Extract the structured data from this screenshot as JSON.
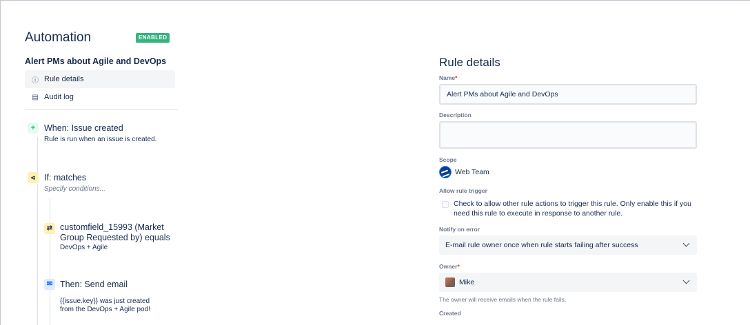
{
  "header": {
    "title": "Automation",
    "status_badge": "ENABLED",
    "rule_name": "Alert PMs about Agile and DevOps"
  },
  "nav": {
    "items": [
      {
        "label": "Rule details",
        "icon": "info-icon",
        "active": true
      },
      {
        "label": "Audit log",
        "icon": "document-icon",
        "active": false
      }
    ]
  },
  "steps": {
    "trigger": {
      "title": "When: Issue created",
      "description": "Rule is run when an issue is created.",
      "icon": "plus-icon",
      "color": "#36b37e"
    },
    "condition": {
      "title": "If: matches",
      "description": "Specify conditions...",
      "icon": "branch-icon",
      "color": "#ffab00"
    },
    "sub_condition": {
      "title_line1": "customfield_15993 (Market",
      "title_line2": "Group Requested by) equals",
      "description": "DevOps + Agile",
      "icon": "shuffle-icon",
      "color": "#ffab00"
    },
    "action": {
      "title": "Then: Send email",
      "description_line1": "{{issue.key}} was just created",
      "description_line2": "from the DevOps + Agile pod!",
      "icon": "email-icon",
      "color": "#0065ff"
    }
  },
  "details": {
    "title": "Rule details",
    "name_label": "Name",
    "name_value": "Alert PMs about Agile and DevOps",
    "description_label": "Description",
    "description_value": "",
    "scope_label": "Scope",
    "scope_value": "Web Team",
    "allow_trigger_label": "Allow rule trigger",
    "allow_trigger_text": "Check to allow other rule actions to trigger this rule. Only enable this if you need this rule to execute in response to another rule.",
    "allow_trigger_checked": false,
    "notify_label": "Notify on error",
    "notify_value": "E-mail rule owner once when rule starts failing after success",
    "owner_label": "Owner",
    "owner_value": "Mike",
    "owner_help": "The owner will receive emails when the rule fails.",
    "created_label": "Created",
    "required_mark": "*"
  }
}
